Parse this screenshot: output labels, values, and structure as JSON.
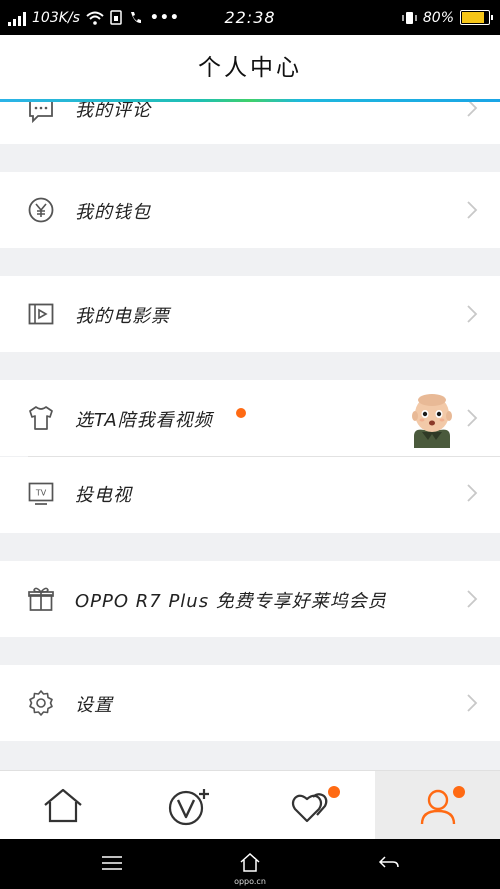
{
  "status_bar": {
    "speed": "103K/s",
    "time": "22:38",
    "battery_percent": "80%",
    "battery_level": 0.8
  },
  "header": {
    "title": "个人中心"
  },
  "menu": {
    "comments": "我的评论",
    "wallet": "我的钱包",
    "tickets": "我的电影票",
    "pick_ta": "选TA陪我看视频",
    "cast_tv": "投电视",
    "oppo": "OPPO R7 Plus 免费专享好莱坞会员",
    "settings": "设置"
  },
  "icons": {
    "comments": "comment-icon",
    "wallet": "yen-icon",
    "tickets": "ticket-icon",
    "pick_ta": "tshirt-icon",
    "cast_tv": "tv-icon",
    "oppo": "gift-icon",
    "settings": "gear-icon"
  },
  "bottom_nav": [
    "home-icon",
    "vplus-icon",
    "hearts-icon",
    "user-icon"
  ],
  "system_nav": {
    "brand": "oppo.cn"
  },
  "colors": {
    "accent_orange": "#ff6a13",
    "accent_blue": "#1aa5e6",
    "icon_gray": "#555555"
  }
}
